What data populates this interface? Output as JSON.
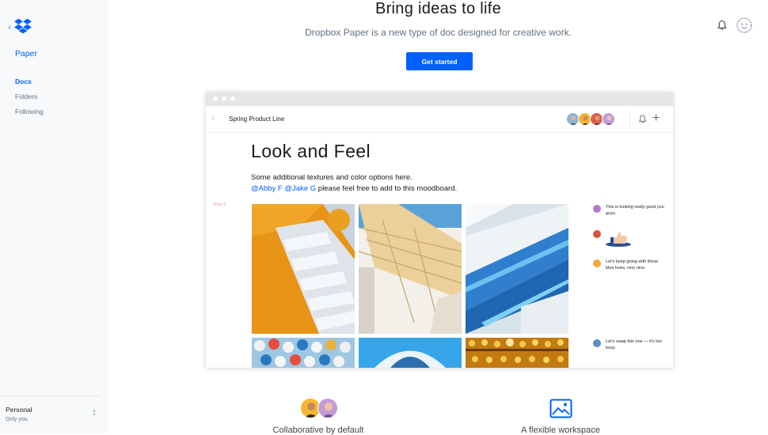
{
  "sidebar": {
    "paper_label": "Paper",
    "nav": [
      {
        "label": "Docs",
        "active": true
      },
      {
        "label": "Folders",
        "active": false
      },
      {
        "label": "Following",
        "active": false
      }
    ],
    "account": {
      "title": "Personal",
      "subtitle": "Only you"
    }
  },
  "hero": {
    "title": "Bring ideas to life",
    "subtitle": "Dropbox Paper is a new type of doc designed for creative work.",
    "cta_label": "Get started"
  },
  "preview": {
    "doc_name": "Spring Product Line",
    "title": "Look and Feel",
    "line1": "Some additional textures and color options here.",
    "mention1": "@Abby F",
    "mention2": "@Jake G",
    "line2_rest": "please feel free to add to this moodboard.",
    "margin_tag": "Shari S",
    "comments": [
      {
        "text": "This is looking really good you guys.",
        "color": "#b47cc7"
      },
      {
        "text": "",
        "color": "#d4553a"
      },
      {
        "text": "Let's keep going with these blue hues, very nice.",
        "color": "#f2a93b"
      },
      {
        "text": "Let's swap this one — it's too busy.",
        "color": "#5b8fc7"
      }
    ]
  },
  "features": [
    {
      "label": "Collaborative by default"
    },
    {
      "label": "A flexible workspace"
    }
  ],
  "colors": {
    "accent": "#0061fe",
    "sidebar_bg": "#f7f9fa"
  }
}
